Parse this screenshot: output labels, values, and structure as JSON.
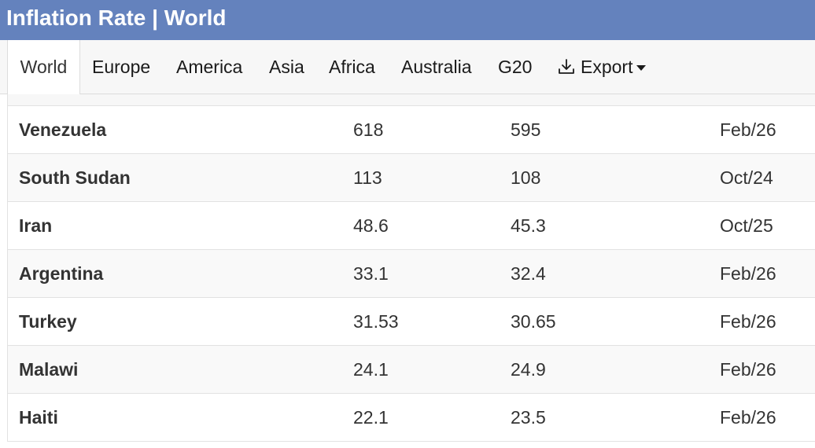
{
  "header": {
    "title": "Inflation Rate | World"
  },
  "tabs": [
    {
      "label": "World",
      "active": true
    },
    {
      "label": "Europe",
      "active": false
    },
    {
      "label": "America",
      "active": false
    },
    {
      "label": "Asia",
      "active": false
    },
    {
      "label": "Africa",
      "active": false
    },
    {
      "label": "Australia",
      "active": false
    },
    {
      "label": "G20",
      "active": false
    }
  ],
  "export": {
    "label": "Export",
    "icon": "download-icon"
  },
  "table": {
    "rows": [
      {
        "country": "Venezuela",
        "last": "618",
        "previous": "595",
        "reference": "Feb/26"
      },
      {
        "country": "South Sudan",
        "last": "113",
        "previous": "108",
        "reference": "Oct/24"
      },
      {
        "country": "Iran",
        "last": "48.6",
        "previous": "45.3",
        "reference": "Oct/25"
      },
      {
        "country": "Argentina",
        "last": "33.1",
        "previous": "32.4",
        "reference": "Feb/26"
      },
      {
        "country": "Turkey",
        "last": "31.53",
        "previous": "30.65",
        "reference": "Feb/26"
      },
      {
        "country": "Malawi",
        "last": "24.1",
        "previous": "24.9",
        "reference": "Feb/26"
      },
      {
        "country": "Haiti",
        "last": "22.1",
        "previous": "23.5",
        "reference": "Feb/26"
      }
    ]
  },
  "colors": {
    "header_bg": "#6482bd",
    "tabbar_bg": "#f7f7f7"
  }
}
